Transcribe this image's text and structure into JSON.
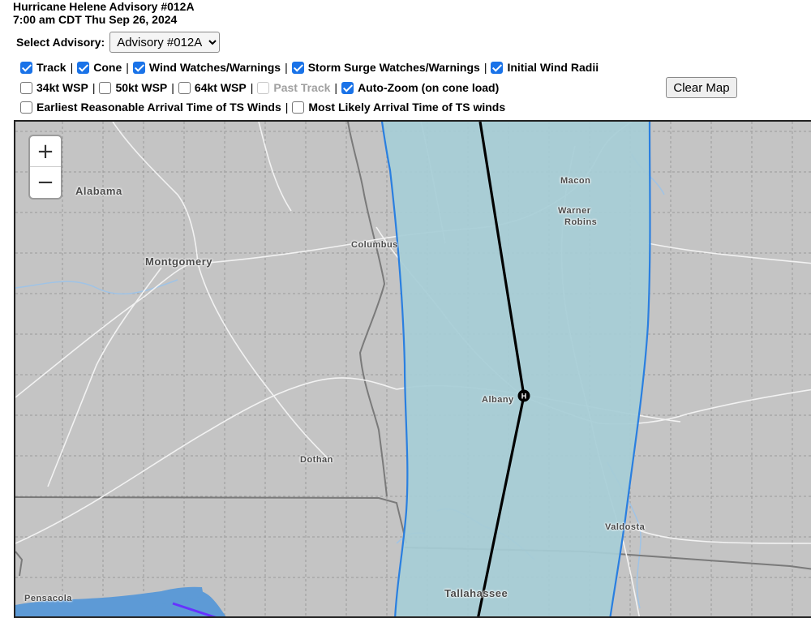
{
  "header": {
    "title": "Hurricane Helene Advisory #012A",
    "time": "7:00 am CDT Thu Sep 26, 2024"
  },
  "advisory_select": {
    "label": "Select Advisory:",
    "selected": "Advisory #012A"
  },
  "options": {
    "track": {
      "label": "Track",
      "checked": true
    },
    "cone": {
      "label": "Cone",
      "checked": true
    },
    "wind_watches": {
      "label": "Wind Watches/Warnings",
      "checked": true
    },
    "storm_surge": {
      "label": "Storm Surge Watches/Warnings",
      "checked": true
    },
    "initial_wind_radii": {
      "label": "Initial Wind Radii",
      "checked": true
    },
    "wsp34": {
      "label": "34kt WSP",
      "checked": false
    },
    "wsp50": {
      "label": "50kt WSP",
      "checked": false
    },
    "wsp64": {
      "label": "64kt WSP",
      "checked": false
    },
    "past_track": {
      "label": "Past Track",
      "checked": false,
      "disabled": true
    },
    "auto_zoom": {
      "label": "Auto-Zoom (on cone load)",
      "checked": true
    },
    "earliest_arrival": {
      "label": "Earliest Reasonable Arrival Time of TS Winds",
      "checked": false
    },
    "likely_arrival": {
      "label": "Most Likely Arrival Time of TS winds",
      "checked": false
    }
  },
  "separator": "|",
  "clear_map_label": "Clear Map",
  "zoom": {
    "in": "+",
    "out": "−"
  },
  "map_labels": {
    "alabama": "Alabama",
    "montgomery": "Montgomery",
    "columbus": "Columbus",
    "macon": "Macon",
    "warner": "Warner",
    "robins": "Robins",
    "albany": "Albany",
    "dothan": "Dothan",
    "valdosta": "Valdosta",
    "pensacola": "Pensacola",
    "tallahassee": "Tallahassee",
    "storm_symbol": "H"
  },
  "colors": {
    "cone_fill": "#a6cdd6",
    "cone_outline": "#2a7fe0",
    "track": "#000000",
    "map_background": "#c4c4c4",
    "roads": "#f2f2f2",
    "rivers": "#9fc3e6",
    "water": "#5d9ad6",
    "warning_line": "#6633ff"
  }
}
